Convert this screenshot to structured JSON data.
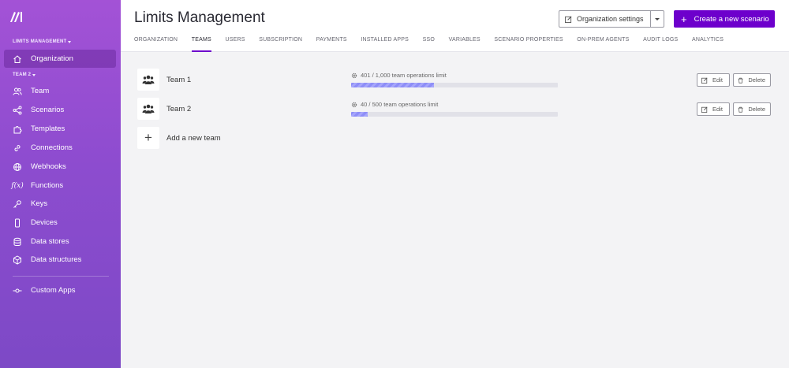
{
  "sidebar": {
    "section_org": "LIMITS MANAGEMENT",
    "section_team": "TEAM 2",
    "org_item": {
      "label": "Organization",
      "icon": "home-icon"
    },
    "items": [
      {
        "label": "Team",
        "icon": "users-icon"
      },
      {
        "label": "Scenarios",
        "icon": "share-nodes-icon"
      },
      {
        "label": "Templates",
        "icon": "puzzle-icon"
      },
      {
        "label": "Connections",
        "icon": "link-icon"
      },
      {
        "label": "Webhooks",
        "icon": "globe-icon"
      },
      {
        "label": "Functions",
        "icon": "function-icon"
      },
      {
        "label": "Keys",
        "icon": "key-icon"
      },
      {
        "label": "Devices",
        "icon": "mobile-icon"
      },
      {
        "label": "Data stores",
        "icon": "database-icon"
      },
      {
        "label": "Data structures",
        "icon": "cube-icon"
      }
    ],
    "custom_apps": {
      "label": "Custom Apps",
      "icon": "commit-icon"
    }
  },
  "header": {
    "title": "Limits Management",
    "org_settings_label": "Organization settings",
    "create_label": "Create a new scenario",
    "tabs": [
      {
        "label": "ORGANIZATION",
        "active": false
      },
      {
        "label": "TEAMS",
        "active": true
      },
      {
        "label": "USERS",
        "active": false
      },
      {
        "label": "SUBSCRIPTION",
        "active": false
      },
      {
        "label": "PAYMENTS",
        "active": false
      },
      {
        "label": "INSTALLED APPS",
        "active": false
      },
      {
        "label": "SSO",
        "active": false
      },
      {
        "label": "VARIABLES",
        "active": false
      },
      {
        "label": "SCENARIO PROPERTIES",
        "active": false
      },
      {
        "label": "ON-PREM AGENTS",
        "active": false
      },
      {
        "label": "AUDIT LOGS",
        "active": false
      },
      {
        "label": "ANALYTICS",
        "active": false
      }
    ]
  },
  "teams": [
    {
      "name": "Team 1",
      "limit_text": "401 / 1,000 team operations limit",
      "used": 401,
      "limit": 1000,
      "edit_label": "Edit",
      "delete_label": "Delete"
    },
    {
      "name": "Team 2",
      "limit_text": "40 / 500 team operations limit",
      "used": 40,
      "limit": 500,
      "edit_label": "Edit",
      "delete_label": "Delete"
    }
  ],
  "add_team_label": "Add a new team",
  "colors": {
    "accent": "#6d00cc",
    "sidebar_top": "#a352d6",
    "sidebar_bottom": "#7d49c6",
    "progress": "#8e8ef7"
  }
}
